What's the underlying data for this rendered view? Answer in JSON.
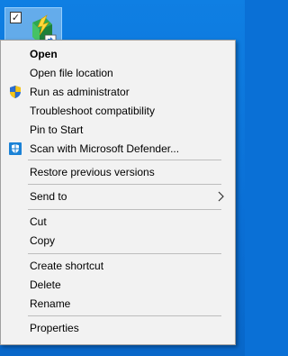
{
  "desktop_icon": {
    "checked_glyph": "✓",
    "icon_name": "app-shortcut-icon"
  },
  "menu": {
    "items": [
      {
        "label": "Open",
        "bold": true
      },
      {
        "label": "Open file location"
      },
      {
        "label": "Run as administrator",
        "icon": "shield-icon"
      },
      {
        "label": "Troubleshoot compatibility"
      },
      {
        "label": "Pin to Start"
      },
      {
        "label": "Scan with Microsoft Defender...",
        "icon": "defender-icon"
      },
      {
        "label": "Restore previous versions"
      },
      {
        "label": "Send to",
        "submenu": true
      },
      {
        "label": "Cut"
      },
      {
        "label": "Copy"
      },
      {
        "label": "Create shortcut"
      },
      {
        "label": "Delete"
      },
      {
        "label": "Rename"
      },
      {
        "label": "Properties"
      }
    ]
  },
  "colors": {
    "desktop": "#0a6fd5",
    "menu_bg": "#f2f2f2",
    "separator": "#bdbdbd",
    "shield_blue": "#2b6ed1",
    "shield_yellow": "#f5c518"
  }
}
